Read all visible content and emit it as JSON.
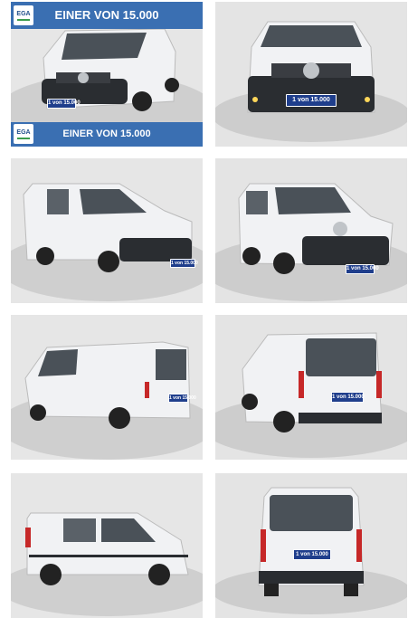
{
  "banner": {
    "logo_text": "EGA",
    "top_text": "EINER VON 15.000",
    "bottom_text": "EINER VON 15.000"
  },
  "plate_text": "1 von 15.000",
  "photos": [
    {
      "view": "front-left"
    },
    {
      "view": "front"
    },
    {
      "view": "side-front-right"
    },
    {
      "view": "front-right-close"
    },
    {
      "view": "rear-left"
    },
    {
      "view": "rear-left-close"
    },
    {
      "view": "side-left"
    },
    {
      "view": "rear"
    }
  ],
  "colors": {
    "banner": "#3a6fb2",
    "van": "#f1f2f4",
    "plate": "#1f3e8c"
  }
}
